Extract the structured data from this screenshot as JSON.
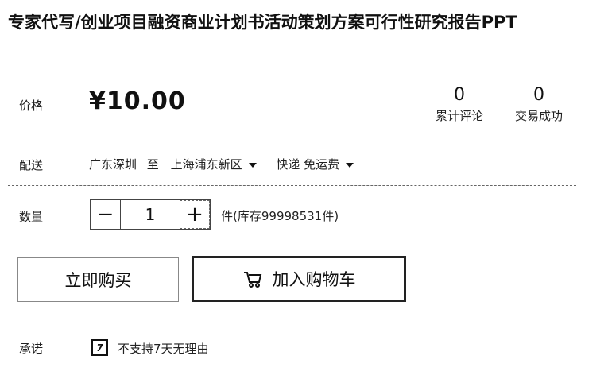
{
  "product": {
    "title": "专家代写/创业项目融资商业计划书活动策划方案可行性研究报告PPT"
  },
  "price": {
    "label": "价格",
    "value": "¥10.00"
  },
  "stats": {
    "reviews": {
      "count": "0",
      "label": "累计评论"
    },
    "transactions": {
      "count": "0",
      "label": "交易成功"
    }
  },
  "shipping": {
    "label": "配送",
    "from": "广东深圳",
    "to_word": "至",
    "destination": "上海浦东新区",
    "method": "快递 免运费"
  },
  "quantity": {
    "label": "数量",
    "minus": "−",
    "value": "1",
    "plus": "+",
    "stock": "件(库存99998531件)"
  },
  "actions": {
    "buy_now": "立即购买",
    "add_to_cart": "加入购物车",
    "cart_icon": "cart-icon"
  },
  "promise": {
    "label": "承诺",
    "icon": "no-return-icon",
    "text": "不支持7天无理由"
  }
}
